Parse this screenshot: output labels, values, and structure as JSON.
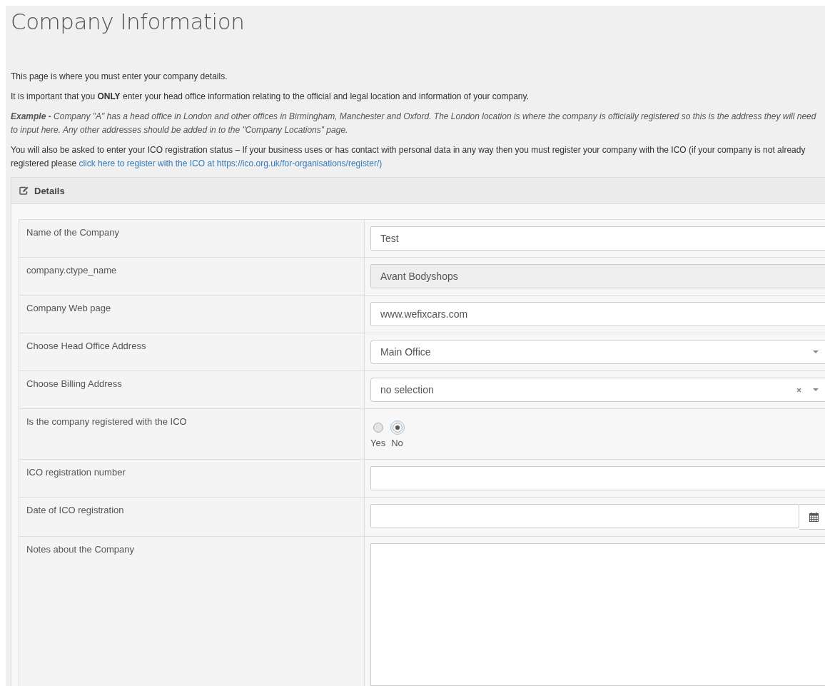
{
  "page": {
    "title": "Company Information"
  },
  "intro": [
    {
      "kind": "plain",
      "text": "This page is where you must enter your company details."
    },
    {
      "kind": "plain",
      "text": "It is important that you **ONLY** enter your head office information relating to the official and legal location and information of your company."
    },
    {
      "kind": "example",
      "text": "**Example -** Company \"A\" has a head office in London and other offices in Birmingham, Manchester and Oxford. The London location is where the company is officially registered so this is the address they will need to input here. Any other addresses should be added in to the \"Company Locations\" page."
    },
    {
      "kind": "link",
      "text": "You will also be asked to enter your ICO registration status – If your business uses or has contact with personal data in any way then you must register your company with the ICO (if your company is not already registered please ",
      "link": "click here to register with the ICO at https://ico.org.uk/for-organisations/register/)"
    }
  ],
  "panel": {
    "title": "Details"
  },
  "fields": [
    {
      "kind": "text",
      "label": "Name of the Company",
      "value": "Test"
    },
    {
      "kind": "readonly",
      "label": "company.ctype_name",
      "value": "Avant Bodyshops"
    },
    {
      "kind": "text",
      "label": "Company Web page",
      "value": "www.wefixcars.com"
    },
    {
      "kind": "select",
      "label": "Choose Head Office Address",
      "value": "Main Office",
      "clearable": false
    },
    {
      "kind": "select",
      "label": "Choose Billing Address",
      "value": "no selection",
      "clearable": true
    },
    {
      "kind": "radio",
      "label": "Is the company registered with the ICO",
      "options": [
        {
          "label": "Yes",
          "selected": false
        },
        {
          "label": "No",
          "selected": true
        }
      ]
    },
    {
      "kind": "text",
      "label": "ICO registration number"
    },
    {
      "kind": "date",
      "label": "Date of ICO registration"
    },
    {
      "kind": "textarea",
      "label": "Notes about the Company"
    }
  ]
}
